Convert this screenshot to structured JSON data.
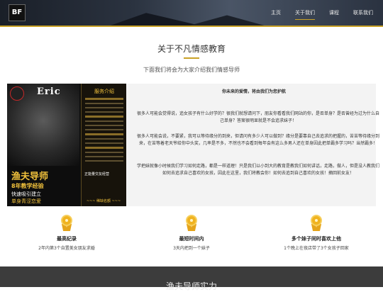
{
  "header": {
    "logo_text": "BF",
    "nav": [
      {
        "label": "主页"
      },
      {
        "label": "关于我们"
      },
      {
        "label": "课程"
      },
      {
        "label": "联系我们"
      }
    ],
    "active_index": 1,
    "accent_color": "#c9a227"
  },
  "intro": {
    "title": "关于不凡情感教育",
    "subtitle": "下面我们将会为大家介绍我们情感导师"
  },
  "poster": {
    "name": "Eric",
    "panel_title": "服务介绍",
    "role": "渔夫导师",
    "headline": "8年教学经验",
    "line1": "快速吸引建立",
    "line2": "单身青涩恋爱",
    "line3": "正能量交友经营",
    "footer": "~~~ 稀缺名额 ~~~"
  },
  "content": {
    "lead": "你未来的爱情，将由我们为您护航",
    "paragraph1": "很多人可能会觉得说，追女孩子有什么好学的？很我们就想请问下，朋友你看看我们网站的你，是否单身？是否曾经为过为什么自己单身？答案很明显就是不会追求妹子！",
    "paragraph2": "很多人可能会说，不要紧，我可以等待缘分的到来，但请问有多少人可以做到？缘分是要靠自己去追求的把握的，苦苦等待缘分到来，在苦等着老天爷给你中头奖，几率是不多，不然也不会看到每年会有这么多男人还在单身因此把单霸多学习吗？当然霸多！",
    "paragraph3": "学把妹就像小时候我们学习如何走路，都是一样道理！只是我们以小到大的教育是教我们如何讲话，走路，做人，但是没人教我们如何去追求自己喜欢的女孩，因此在这里，我们将教会你！如何去追到自己喜欢的女孩！摘回前女友！"
  },
  "stats": [
    {
      "title": "最高纪录",
      "desc": "2年内第3个自置美女朋友求婚",
      "icon": "medal-icon"
    },
    {
      "title": "最短时间内",
      "desc": "3天内把到一个妹子",
      "icon": "medal-icon"
    },
    {
      "title": "多个妹子同时喜欢上他",
      "desc": "1个晚上在夜店带了3个女孩子回家",
      "icon": "medal-icon"
    }
  ],
  "footer": {
    "title": "渔夫导师实力"
  }
}
